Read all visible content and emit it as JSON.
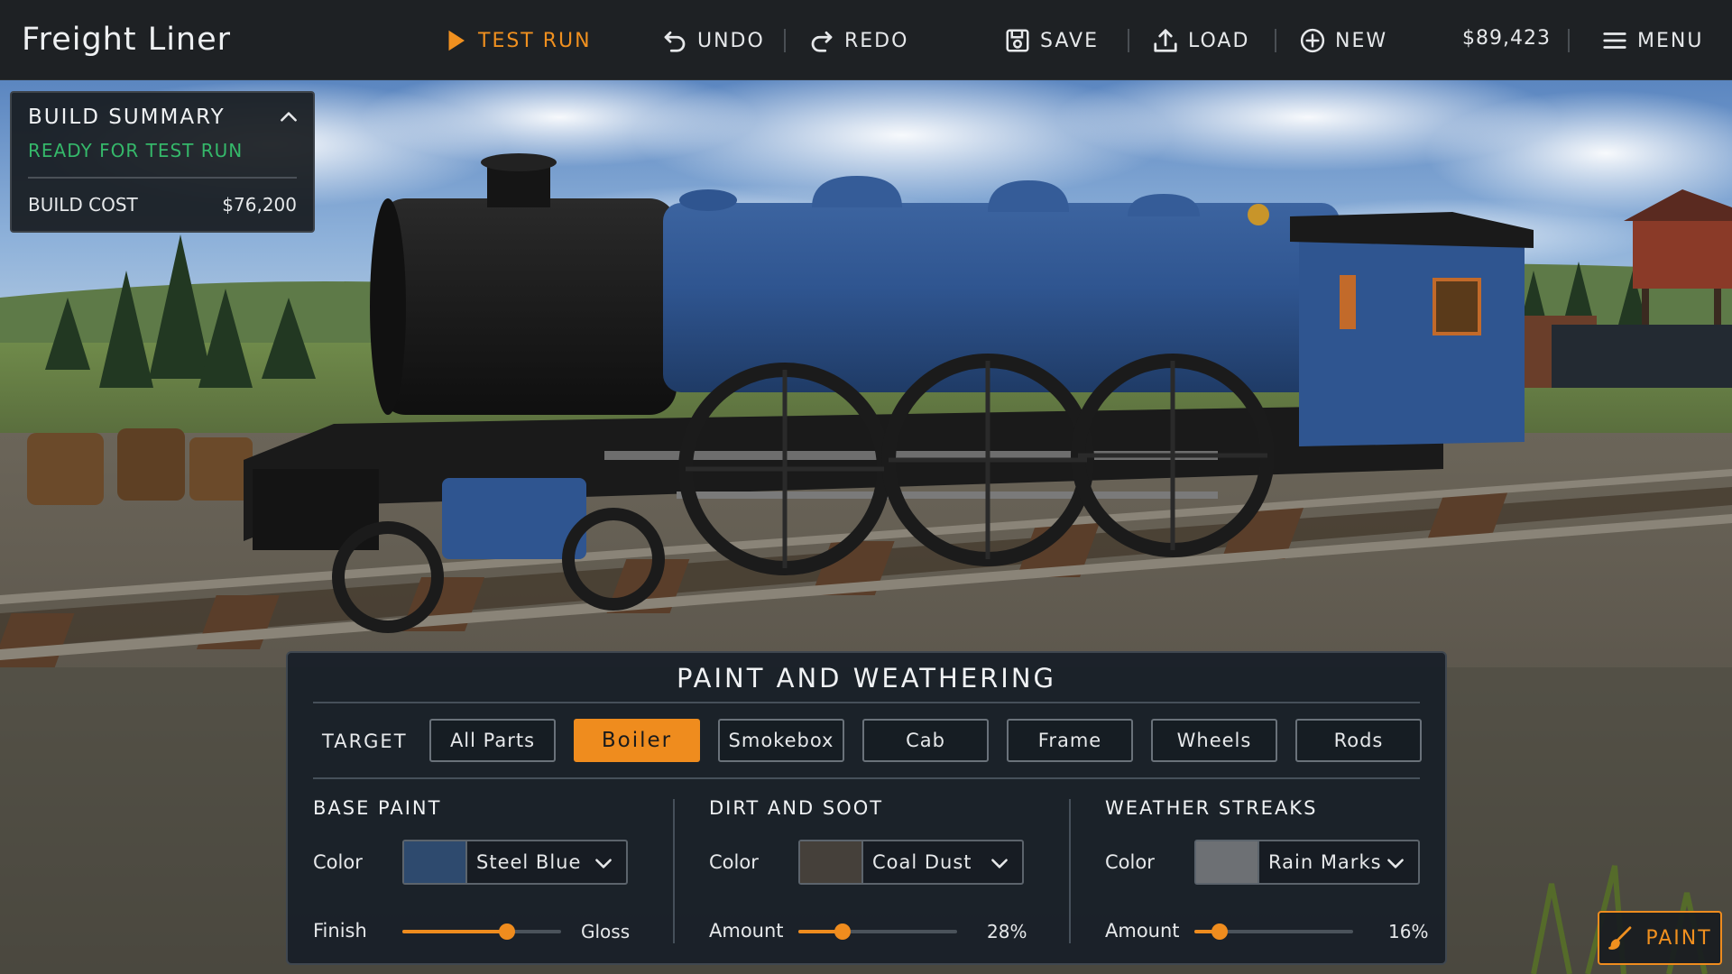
{
  "app": {
    "title": "Freight Liner"
  },
  "toolbar": {
    "test_run": "TEST RUN",
    "undo": "UNDO",
    "redo": "REDO",
    "save": "SAVE",
    "load": "LOAD",
    "new": "NEW",
    "money": "$89,423",
    "menu": "MENU"
  },
  "build_summary": {
    "title": "BUILD SUMMARY",
    "status": "READY FOR TEST RUN",
    "cost_label": "BUILD COST",
    "cost_value": "$76,200"
  },
  "paint_panel": {
    "title": "PAINT AND WEATHERING",
    "target_label": "TARGET",
    "targets": [
      "All Parts",
      "Boiler",
      "Smokebox",
      "Cab",
      "Frame",
      "Wheels",
      "Rods"
    ],
    "active_target": "Boiler",
    "base_paint": {
      "title": "BASE PAINT",
      "color_label": "Color",
      "color_value": "Steel Blue",
      "swatch": "#2e4a6e",
      "finish_label": "Finish",
      "finish_end_label": "Gloss",
      "finish_level": 0.66
    },
    "dirt_soot": {
      "title": "DIRT AND SOOT",
      "color_label": "Color",
      "color_value": "Coal Dust",
      "swatch": "#45403a",
      "amount_label": "Amount",
      "amount_text": "28%",
      "amount_level": 0.28
    },
    "weather_streaks": {
      "title": "WEATHER STREAKS",
      "color_label": "Color",
      "color_value": "Rain Marks",
      "swatch": "#6d7074",
      "amount_label": "Amount",
      "amount_text": "16%",
      "amount_level": 0.16
    }
  },
  "paint_button": {
    "label": "PAINT"
  },
  "colors": {
    "accent": "#ef8c1e",
    "ready": "#35b86a",
    "panel": "#182028",
    "topbar": "#1e2124"
  }
}
